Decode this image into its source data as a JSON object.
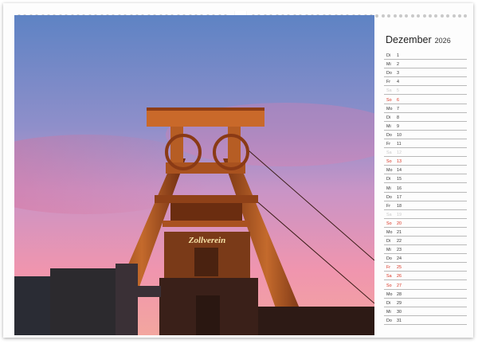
{
  "calendar": {
    "month": "Dezember",
    "year": "2026",
    "days": [
      {
        "wd": "Di",
        "dn": "1",
        "kind": "week"
      },
      {
        "wd": "Mi",
        "dn": "2",
        "kind": "week"
      },
      {
        "wd": "Do",
        "dn": "3",
        "kind": "week"
      },
      {
        "wd": "Fr",
        "dn": "4",
        "kind": "week"
      },
      {
        "wd": "Sa",
        "dn": "5",
        "kind": "sat"
      },
      {
        "wd": "So",
        "dn": "6",
        "kind": "sun"
      },
      {
        "wd": "Mo",
        "dn": "7",
        "kind": "week"
      },
      {
        "wd": "Di",
        "dn": "8",
        "kind": "week"
      },
      {
        "wd": "Mi",
        "dn": "9",
        "kind": "week"
      },
      {
        "wd": "Do",
        "dn": "10",
        "kind": "week"
      },
      {
        "wd": "Fr",
        "dn": "11",
        "kind": "week"
      },
      {
        "wd": "Sa",
        "dn": "12",
        "kind": "sat"
      },
      {
        "wd": "So",
        "dn": "13",
        "kind": "sun"
      },
      {
        "wd": "Mo",
        "dn": "14",
        "kind": "week"
      },
      {
        "wd": "Di",
        "dn": "15",
        "kind": "week"
      },
      {
        "wd": "Mi",
        "dn": "16",
        "kind": "week"
      },
      {
        "wd": "Do",
        "dn": "17",
        "kind": "week"
      },
      {
        "wd": "Fr",
        "dn": "18",
        "kind": "week"
      },
      {
        "wd": "Sa",
        "dn": "19",
        "kind": "sat"
      },
      {
        "wd": "So",
        "dn": "20",
        "kind": "sun"
      },
      {
        "wd": "Mo",
        "dn": "21",
        "kind": "week"
      },
      {
        "wd": "Di",
        "dn": "22",
        "kind": "week"
      },
      {
        "wd": "Mi",
        "dn": "23",
        "kind": "week"
      },
      {
        "wd": "Do",
        "dn": "24",
        "kind": "week"
      },
      {
        "wd": "Fr",
        "dn": "25",
        "kind": "sun"
      },
      {
        "wd": "Sa",
        "dn": "26",
        "kind": "sun"
      },
      {
        "wd": "So",
        "dn": "27",
        "kind": "sun"
      },
      {
        "wd": "Mo",
        "dn": "28",
        "kind": "week"
      },
      {
        "wd": "Di",
        "dn": "29",
        "kind": "week"
      },
      {
        "wd": "Mi",
        "dn": "30",
        "kind": "week"
      },
      {
        "wd": "Do",
        "dn": "31",
        "kind": "week"
      }
    ]
  },
  "photo": {
    "sign_text": "Zollverein",
    "colors": {
      "sky_top": "#5f86c6",
      "sky_mid": "#b98bc4",
      "sky_low": "#e98ea8",
      "tower": "#b45a25",
      "tower_dark": "#4d1f0a",
      "building": "#3a2019"
    }
  },
  "colors": {
    "sunday_red": "#d9301e",
    "saturday_grey": "#c9c9c9"
  }
}
